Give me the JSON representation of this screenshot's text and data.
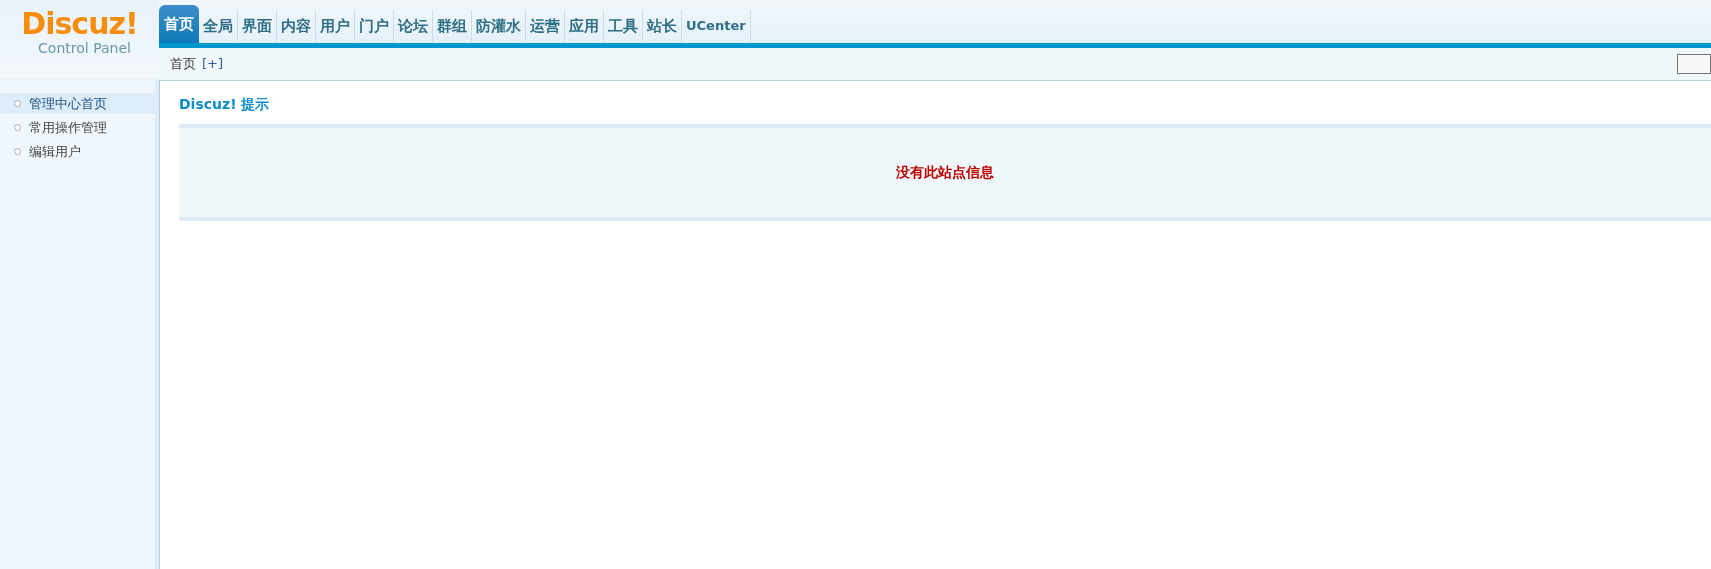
{
  "logo": {
    "title": "Discuz!",
    "subtitle": "Control Panel"
  },
  "nav": [
    {
      "label": "首页",
      "selected": true
    },
    {
      "label": "全局",
      "selected": false
    },
    {
      "label": "界面",
      "selected": false
    },
    {
      "label": "内容",
      "selected": false
    },
    {
      "label": "用户",
      "selected": false
    },
    {
      "label": "门户",
      "selected": false
    },
    {
      "label": "论坛",
      "selected": false
    },
    {
      "label": "群组",
      "selected": false
    },
    {
      "label": "防灌水",
      "selected": false
    },
    {
      "label": "运营",
      "selected": false
    },
    {
      "label": "应用",
      "selected": false
    },
    {
      "label": "工具",
      "selected": false
    },
    {
      "label": "站长",
      "selected": false
    },
    {
      "label": "UCenter",
      "selected": false
    }
  ],
  "breadcrumb": {
    "label": "首页",
    "add": "[+]"
  },
  "sidebar": {
    "items": [
      {
        "label": "管理中心首页",
        "selected": true
      },
      {
        "label": "常用操作管理",
        "selected": false
      },
      {
        "label": "编辑用户",
        "selected": false
      }
    ]
  },
  "content": {
    "title": "Discuz! 提示",
    "message": "没有此站点信息"
  }
}
